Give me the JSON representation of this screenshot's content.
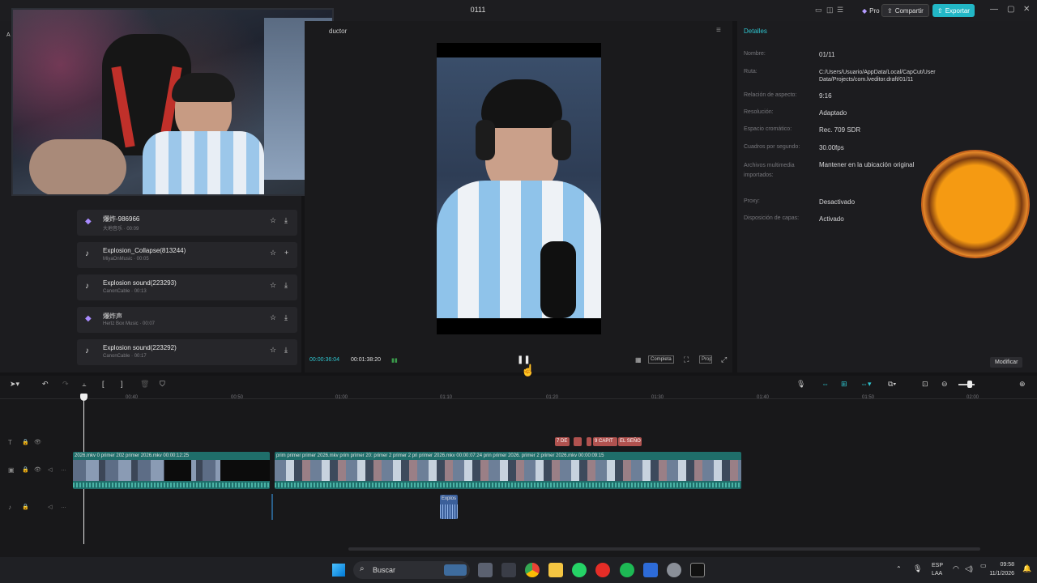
{
  "window": {
    "title": "0111"
  },
  "header": {
    "pro_label": "Pro",
    "share_label": "Compartir",
    "export_label": "Exportar"
  },
  "left_panel": {
    "tab_a": "A",
    "sounds": [
      {
        "title": "爆炸-986966",
        "subtitle": "大地音乐 · 00:09"
      },
      {
        "title": "Explosion_Collapse(813244)",
        "subtitle": "MiyaOnMusic · 00:05"
      },
      {
        "title": "Explosion sound(223293)",
        "subtitle": "CanonCable · 00:13"
      },
      {
        "title": "爆炸声",
        "subtitle": "Hertz Box Music · 00:07"
      },
      {
        "title": "Explosion sound(223292)",
        "subtitle": "CanonCable · 00:17"
      }
    ]
  },
  "player": {
    "title": "ductor",
    "current_time": "00:00:36:04",
    "total_time": "00:01:38:20",
    "fit_label": "Completa",
    "ratio_label": "Proporción"
  },
  "details": {
    "title": "Detalles",
    "rows": [
      {
        "k": "Nombre:",
        "v": "01/11"
      },
      {
        "k": "Ruta:",
        "v": "C:/Users/Usuario/AppData/Local/CapCut/User Data/Projects/com.lveditor.draft/01/11"
      },
      {
        "k": "Relación de aspecto:",
        "v": "9:16"
      },
      {
        "k": "Resolución:",
        "v": "Adaptado"
      },
      {
        "k": "Espacio cromático:",
        "v": "Rec. 709 SDR"
      },
      {
        "k": "Cuadros por segundo:",
        "v": "30.00fps"
      },
      {
        "k": "Archivos multimedia importados:",
        "v": "Mantener en la ubicación original"
      },
      {
        "k": "Proxy:",
        "v": "Desactivado"
      },
      {
        "k": "Disposición de capas:",
        "v": "Activado"
      }
    ],
    "modify_label": "Modificar"
  },
  "timeline": {
    "ticks": [
      "00:40",
      "00:50",
      "01:00",
      "01:10",
      "01:20",
      "01:30",
      "01:40",
      "01:50",
      "02:00"
    ],
    "text_clips": [
      "7 DE",
      "9 CAPIT",
      "EL SEÑO"
    ],
    "video_clip1": "2026.mkv  0  primer 202  primer 2026.mkv  00:00:12:25",
    "video_clip2": "prim  primer  primer 2026.mkv  prim  primer 20:  primer 2  primer 2  pri  primer 2026.mkv  00:00:07:24  prin  primer 2026.  primer 2  primer 2026.mkv  00:00:09:15",
    "audio_clip": "Explos"
  },
  "taskbar": {
    "search_label": "Buscar",
    "lang": "ESP",
    "lang2": "LAA",
    "time": "09:58",
    "date": "11/1/2026"
  },
  "colors": {
    "accent": "#22b7c6",
    "clip": "#1f6e6a",
    "text_clip": "#b0524f"
  }
}
